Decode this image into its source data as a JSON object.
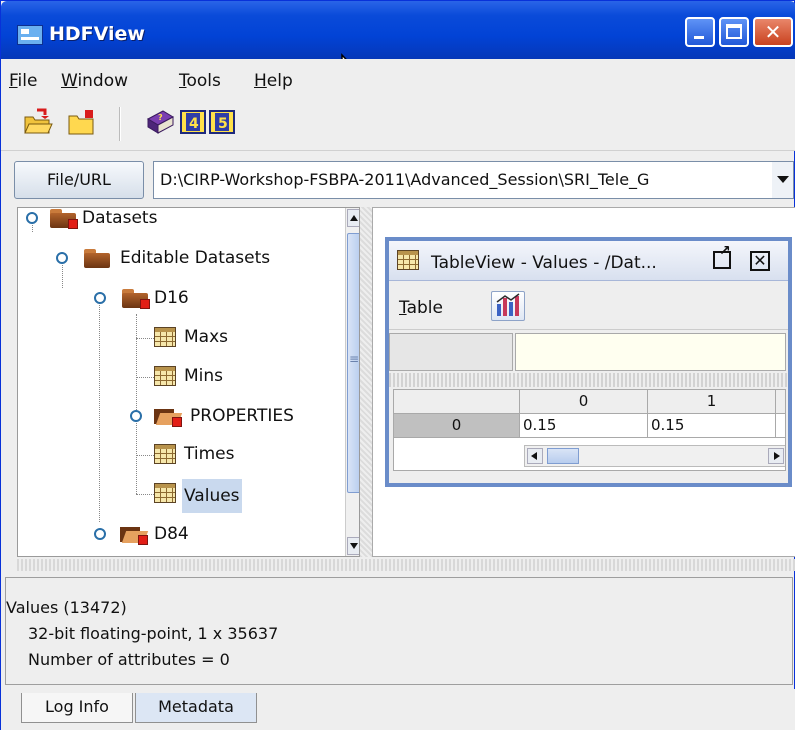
{
  "window": {
    "title": "HDFView"
  },
  "menubar": {
    "items": [
      {
        "label": "File",
        "mnemonic": "F"
      },
      {
        "label": "Window",
        "mnemonic": "W"
      },
      {
        "label": "Tools",
        "mnemonic": "T"
      },
      {
        "label": "Help",
        "mnemonic": "H"
      }
    ]
  },
  "toolbar": {
    "buttons": [
      {
        "icon": "open-folder-icon"
      },
      {
        "icon": "new-folder-icon"
      },
      {
        "icon": "help-book-icon"
      },
      {
        "icon": "hdf4-icon"
      },
      {
        "icon": "hdf5-icon"
      }
    ]
  },
  "urlbar": {
    "button_label": "File/URL",
    "value": "D:\\CIRP-Workshop-FSBPA-2011\\Advanced_Session\\SRI_Tele_G"
  },
  "tree": {
    "nodes": [
      {
        "label": "Datasets"
      },
      {
        "label": "Editable Datasets"
      },
      {
        "label": "D16"
      },
      {
        "label": "Maxs"
      },
      {
        "label": "Mins"
      },
      {
        "label": "PROPERTIES"
      },
      {
        "label": "Times"
      },
      {
        "label": "Values",
        "selected": true
      },
      {
        "label": "D84"
      }
    ]
  },
  "tableview": {
    "title": "TableView  -  Values  -  /Dat...",
    "menu_label": "Table",
    "menu_mnemonic": "T",
    "columns": [
      "0",
      "1"
    ],
    "row_header": "0",
    "cells": [
      "0.15",
      "0.15"
    ]
  },
  "info": {
    "line1": "Values (13472)",
    "line2": "32-bit floating-point,    1 x 35637",
    "line3": "Number of attributes = 0"
  },
  "bottom_tabs": [
    {
      "label": "Log Info"
    },
    {
      "label": "Metadata",
      "active": true
    }
  ],
  "colors": {
    "xp_title_blue": "#0243d6",
    "selection": "#c9d9ee",
    "editor_cell": "#fffff0"
  }
}
